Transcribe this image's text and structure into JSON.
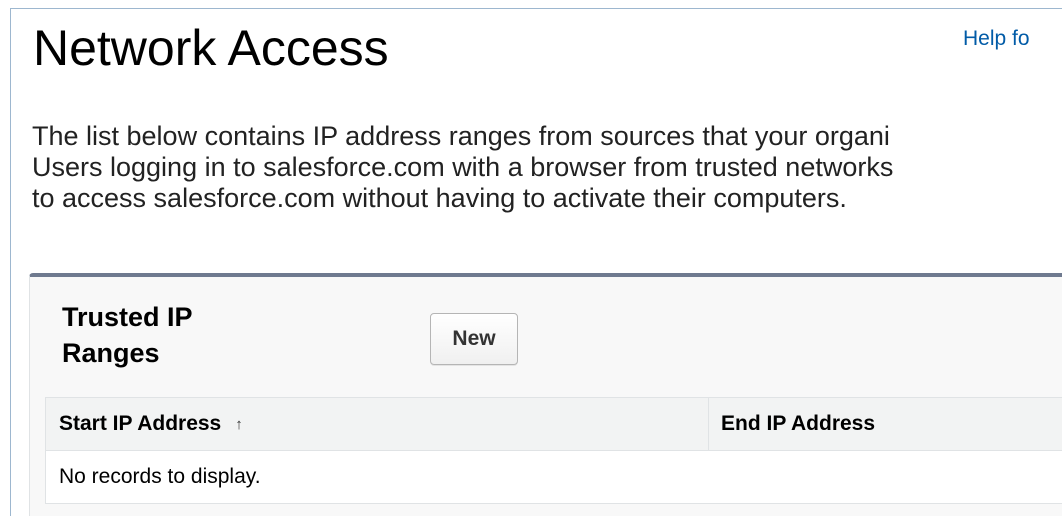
{
  "header": {
    "title": "Network Access",
    "help_link": "Help fo"
  },
  "description": {
    "lines": [
      "The list below contains IP address ranges from sources that your organi",
      "Users logging in to salesforce.com with a browser from trusted networks",
      "to access salesforce.com without having to activate their computers."
    ]
  },
  "trusted_ip_panel": {
    "title": "Trusted IP Ranges",
    "new_button_label": "New",
    "columns": [
      {
        "label": "Start IP Address",
        "sort_icon": "arrow-up-icon",
        "sort_glyph": "↑"
      },
      {
        "label": "End IP Address"
      }
    ],
    "empty_message": "No records to display."
  },
  "colors": {
    "link": "#015ba7",
    "panel_border_top": "#6f7a8f",
    "panel_background": "#f8f8f8",
    "header_row_background": "#f2f3f3"
  }
}
